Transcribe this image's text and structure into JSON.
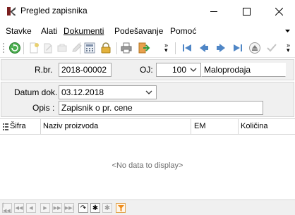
{
  "window": {
    "title": "Pregled zapisnika"
  },
  "menu": {
    "items": [
      "Stavke",
      "Alati",
      "Dokumenti",
      "Podešavanje",
      "Pomoć"
    ]
  },
  "header": {
    "rbr_label": "R.br.",
    "rbr_value": "2018-00002",
    "oj_label": "OJ:",
    "oj_value": "100",
    "oj_name": "Maloprodaja"
  },
  "document": {
    "date_label": "Datum dok.",
    "date_value": "03.12.2018",
    "opis_label": "Opis :",
    "opis_value": "Zapisnik o pr. cene"
  },
  "grid": {
    "columns": [
      "Šifra",
      "Naziv proizvoda",
      "EM",
      "Količina"
    ],
    "empty_text": "<No data to display>"
  },
  "colors": {
    "accent_blue": "#3d7fd3",
    "refresh_green": "#39a043",
    "lock_yellow": "#d9a531",
    "filter_orange": "#ef8b1a"
  }
}
